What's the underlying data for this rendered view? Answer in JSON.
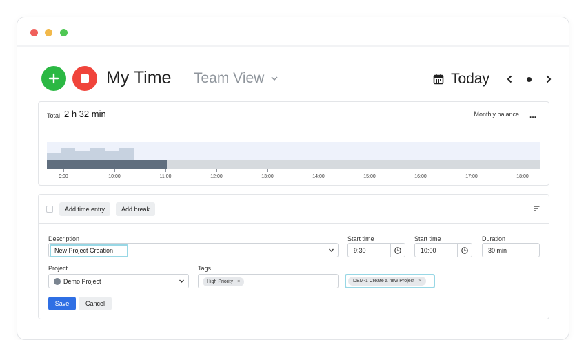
{
  "header": {
    "title": "My Time",
    "team_view": "Team View",
    "today": "Today"
  },
  "summary": {
    "total_label": "Total",
    "total_value": "2 h 32 min",
    "monthly_balance": "Monthly balance",
    "more": "..."
  },
  "timeline": {
    "ticks": [
      "9:00",
      "10:00",
      "11:00",
      "12:00",
      "13:00",
      "14:00",
      "15:00",
      "16:00",
      "17:00",
      "18:00"
    ]
  },
  "toolbar": {
    "add_time_entry": "Add time entry",
    "add_break": "Add break"
  },
  "form": {
    "description_label": "Description",
    "description_value": "New Project Creation",
    "start_time_label": "Start time",
    "start_time_value": "9:30",
    "end_time_label": "Start time",
    "end_time_value": "10:00",
    "duration_label": "Duration",
    "duration_value": "30 min",
    "project_label": "Project",
    "project_value": "Demo Project",
    "tags_label": "Tags",
    "tag_chip": "High Priority",
    "jira_chip": "DEM-1 Create a new Project",
    "save": "Save",
    "cancel": "Cancel"
  },
  "colors": {
    "add": "#2bb843",
    "stop": "#f0443b",
    "save": "#2f6fe4",
    "focus": "#98d7e5"
  }
}
